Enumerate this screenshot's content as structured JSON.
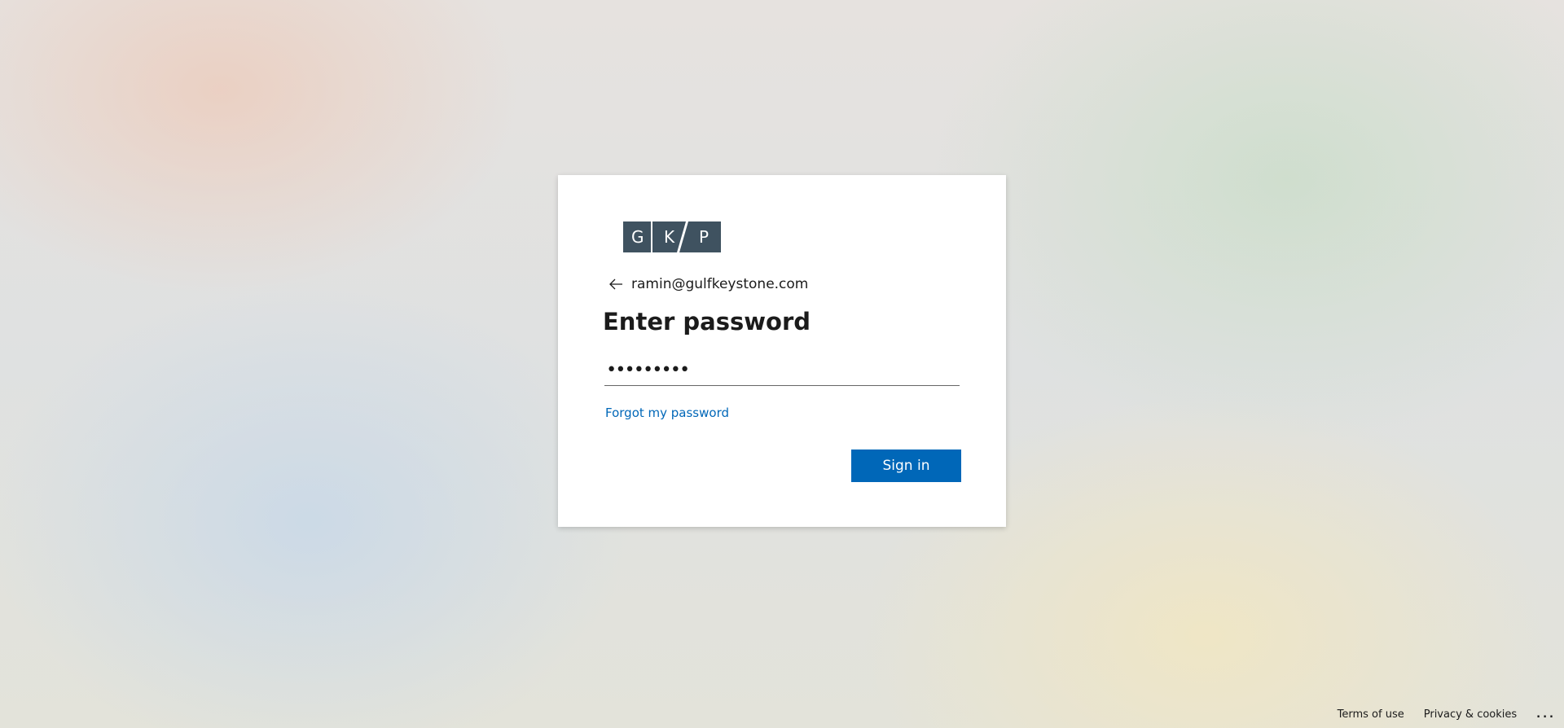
{
  "logo": {
    "letters": [
      "G",
      "K",
      "P"
    ],
    "color": "#3f5260",
    "name": "GKP"
  },
  "identity": {
    "back_icon": "arrow-left-icon",
    "email": "ramin@gulfkeystone.com"
  },
  "form": {
    "title": "Enter password",
    "password_value": "•••••••••",
    "forgot_link": "Forgot my password",
    "signin_label": "Sign in"
  },
  "footer": {
    "terms": "Terms of use",
    "privacy": "Privacy & cookies",
    "more": "..."
  },
  "colors": {
    "accent": "#0067b8",
    "text": "#1b1b1b",
    "card": "#ffffff"
  }
}
